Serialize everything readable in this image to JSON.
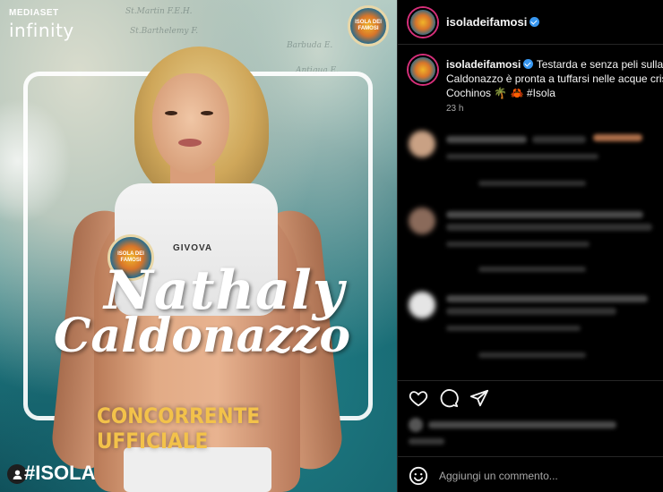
{
  "image": {
    "brand_top": "MEDIASET",
    "brand_bottom": "infinity",
    "shirt_brand": "GIVOVA",
    "name_first": "Nathaly",
    "name_last": "Caldonazzo",
    "role": "CONCORRENTE UFFICIALE",
    "hashtag": "#ISOLA",
    "badge_text": "ISOLA DEI FAMOSI",
    "map_labels": [
      "St.Martin F.E.H.",
      "St.Barthelemy F.",
      "Barbuda E.",
      "Antigua E."
    ],
    "colors": {
      "role": "#f3c24a",
      "frame": "#ffffff",
      "sea": "#1b6f78"
    }
  },
  "panel": {
    "header": {
      "username": "isoladeifamosi",
      "verified": true
    },
    "caption": {
      "username": "isoladeifamosi",
      "line1": "Testarda e senza peli sulla lingua,",
      "line2": "Caldonazzo è pronta a tuffarsi nelle acque cristalline di",
      "line3": "Cochinos 🌴 🦀 #Isola"
    },
    "time": "23 h",
    "comments_note": "blurred",
    "actions": {
      "like": "heart-icon",
      "comment": "comment-icon",
      "share": "send-icon"
    },
    "add_comment": {
      "placeholder": "Aggiungi un commento..."
    },
    "colors": {
      "background": "#000000",
      "text": "#f5f5f5",
      "muted": "#a8a8a8",
      "divider": "#262626",
      "verified": "#3897f0"
    }
  }
}
